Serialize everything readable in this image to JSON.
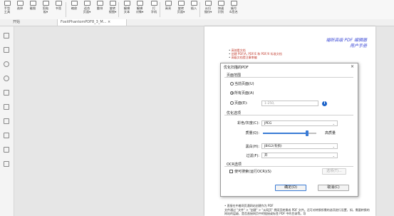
{
  "ribbon": {
    "buttons": [
      {
        "label": "手型\n工具",
        "icon": "hand-icon"
      },
      {
        "label": "选择",
        "icon": "select-icon"
      },
      {
        "label": "截图",
        "icon": "snapshot-icon"
      },
      {
        "label": "剪贴\n板▾",
        "icon": "clipboard-icon"
      },
      {
        "label": "书签",
        "icon": "bookmark-icon"
      },
      {
        "label": "缩放",
        "icon": "zoom-icon"
      },
      {
        "label": "适合\n页面▾",
        "icon": "fit-page-icon"
      },
      {
        "label": "重排",
        "icon": "reflow-icon"
      },
      {
        "label": "旋转\n视图▾",
        "icon": "rotate-icon"
      },
      {
        "label": "编辑\n文本",
        "icon": "edit-text-icon"
      },
      {
        "label": "编辑\n对象▾",
        "icon": "edit-object-icon"
      },
      {
        "label": "打\n字机",
        "icon": "typewriter-icon"
      },
      {
        "label": "高亮",
        "icon": "highlight-icon"
      },
      {
        "label": "旋转\n页面▾",
        "icon": "rotate-page-icon"
      },
      {
        "label": "插入",
        "icon": "insert-icon"
      },
      {
        "label": "从扫\n描仪▾",
        "icon": "scanner-icon"
      },
      {
        "label": "快速\n识别",
        "icon": "ocr-icon"
      },
      {
        "label": "填写\n&签名",
        "icon": "fill-sign-icon"
      }
    ]
  },
  "tabs": [
    {
      "label": "开始"
    },
    {
      "label": "FoxitPhantomPDF8_3_M...  ×"
    }
  ],
  "sidebar": {
    "icons": [
      "bookmark-panel-icon",
      "pages-panel-icon",
      "comments-panel-icon",
      "layers-panel-icon",
      "attachments-panel-icon",
      "security-panel-icon",
      "signature-panel-icon",
      "content-panel-icon",
      "pen-panel-icon",
      "properties-panel-icon"
    ]
  },
  "page": {
    "title_line1": "福昕高级 PDF 编辑器",
    "title_line2": "用户手册",
    "links": [
      "高效看文档",
      "创建 PDF/A, PDF/E 和 PDF/X 标准文档",
      "高级文档提注事审编"
    ],
    "bottom_heading": "直接在中着网页通网站创建作为 PDF",
    "bottom_text": "文件通过 \"文件\" > \"创建\" > \"从网页\" 将网页转换成 PDF 文件。还可对转换所需的选项进行设置，如，需要转换的网站的层级、是否直接网页中的链接或标签 PDF 中的目录等。导"
  },
  "dialog": {
    "title": "优化扫描的PDF",
    "close": "×",
    "page_range": {
      "label": "页面范围",
      "current": "当前页面(U)",
      "all": "所有页面(A)",
      "pages": "页面(E):",
      "pages_placeholder": "1-250,"
    },
    "optimize": {
      "label": "优化选项",
      "color_label": "彩色/灰度(C):",
      "color_value": "JPEG",
      "quality_label": "质量(Q):",
      "quality_high": "高质量",
      "quality_level": 0.82,
      "mono_label": "黑白(H):",
      "mono_value": "JBIG2(有损)",
      "filter_label": "过滤(F):",
      "filter_value": "开"
    },
    "ocr": {
      "label": "OCR选项",
      "checkbox": "使可搜索(运行OCR)(S)",
      "settings_button": "选项(T)..."
    },
    "ok": "确定(O)",
    "cancel": "取消(C)"
  },
  "colors": {
    "accent": "#3a7bd5",
    "title_blue": "#3d4bd6",
    "link_red": "#c0392b"
  }
}
